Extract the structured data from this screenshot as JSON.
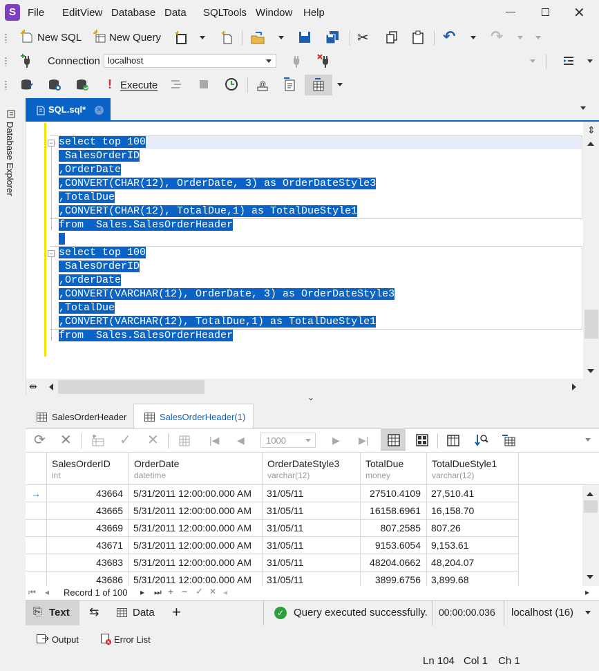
{
  "app": {
    "logo_letter": "S"
  },
  "menu": [
    "File",
    "Edit",
    "View",
    "Database",
    "Data",
    "SQL",
    "Tools",
    "Window",
    "Help"
  ],
  "toolbar1": {
    "new_sql": "New SQL",
    "new_query": "New Query"
  },
  "connection": {
    "label": "Connection",
    "value": "localhost"
  },
  "toolbar3": {
    "execute": "Execute",
    "execute_bang": "!"
  },
  "side_panel": {
    "label": "Database Explorer"
  },
  "doc_tab": {
    "label": "SQL.sql*"
  },
  "editor": {
    "lines": [
      "select top 100",
      " SalesOrderID",
      ",OrderDate",
      ",CONVERT(CHAR(12), OrderDate, 3) as OrderDateStyle3",
      ",TotalDue",
      ",CONVERT(CHAR(12), TotalDue,1) as TotalDueStyle1",
      "from  Sales.SalesOrderHeader",
      " ",
      "select top 100",
      " SalesOrderID",
      ",OrderDate",
      ",CONVERT(VARCHAR(12), OrderDate, 3) as OrderDateStyle3",
      ",TotalDue",
      ",CONVERT(VARCHAR(12), TotalDue,1) as TotalDueStyle1",
      "from  Sales.SalesOrderHeader"
    ]
  },
  "result_tabs": [
    "SalesOrderHeader",
    "SalesOrderHeader(1)"
  ],
  "grid_toolbar": {
    "page_size": "1000"
  },
  "grid": {
    "columns": [
      {
        "name": "SalesOrderID",
        "type": "int"
      },
      {
        "name": "OrderDate",
        "type": "datetime"
      },
      {
        "name": "OrderDateStyle3",
        "type": "varchar(12)"
      },
      {
        "name": "TotalDue",
        "type": "money"
      },
      {
        "name": "TotalDueStyle1",
        "type": "varchar(12)"
      }
    ],
    "rows": [
      [
        "43664",
        "5/31/2011 12:00:00.000 AM",
        "31/05/11",
        "27510.4109",
        "27,510.41"
      ],
      [
        "43665",
        "5/31/2011 12:00:00.000 AM",
        "31/05/11",
        "16158.6961",
        "16,158.70"
      ],
      [
        "43669",
        "5/31/2011 12:00:00.000 AM",
        "31/05/11",
        "807.2585",
        "807.26"
      ],
      [
        "43671",
        "5/31/2011 12:00:00.000 AM",
        "31/05/11",
        "9153.6054",
        "9,153.61"
      ],
      [
        "43683",
        "5/31/2011 12:00:00.000 AM",
        "31/05/11",
        "48204.0662",
        "48,204.07"
      ],
      [
        "43686",
        "5/31/2011 12:00:00.000 AM",
        "31/05/11",
        "3899.6756",
        "3,899.68"
      ]
    ],
    "record_text": "Record 1 of 100"
  },
  "bottom_bar": {
    "text_tab": "Text",
    "data_tab": "Data",
    "add": "+",
    "status": "Query executed successfully.",
    "elapsed": "00:00:00.036",
    "server": "localhost (16)"
  },
  "panels": {
    "output": "Output",
    "error_list": "Error List"
  },
  "status_bar": {
    "ln": "Ln 104",
    "col": "Col 1",
    "ch": "Ch 1"
  },
  "colors": {
    "accent": "#0a64c8",
    "logo": "#7b3fbf",
    "success": "#2e9e3e",
    "error": "#d42a2a"
  }
}
